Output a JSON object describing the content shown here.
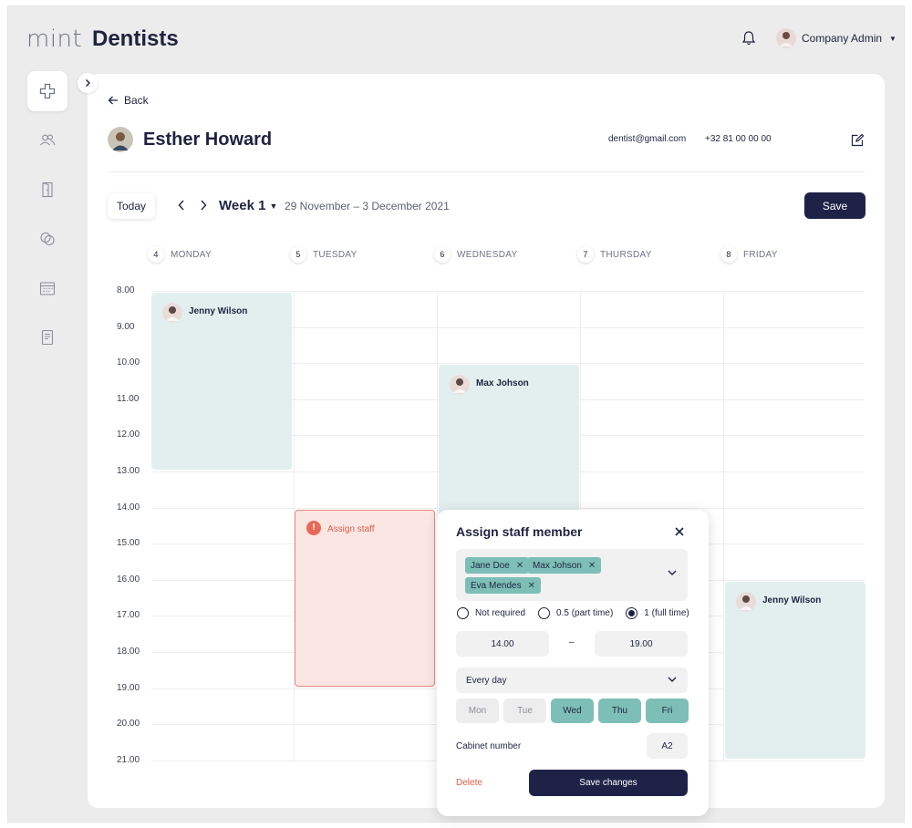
{
  "app": {
    "logo": "mint",
    "title": "Dentists"
  },
  "header": {
    "user_name": "Company Admin"
  },
  "sidebar": {
    "items": [
      {
        "icon": "cross-icon",
        "active": true
      },
      {
        "icon": "users-icon",
        "active": false
      },
      {
        "icon": "door-icon",
        "active": false
      },
      {
        "icon": "circles-icon",
        "active": false
      },
      {
        "icon": "calendar-icon",
        "active": false
      },
      {
        "icon": "document-icon",
        "active": false
      }
    ]
  },
  "profile": {
    "back_label": "Back",
    "name": "Esther Howard",
    "email": "dentist@gmail.com",
    "phone": "+32 81 00 00 00"
  },
  "toolbar": {
    "today_label": "Today",
    "week_label": "Week 1",
    "date_range": "29 November – 3 December 2021",
    "save_label": "Save"
  },
  "calendar": {
    "days": [
      {
        "num": "4",
        "name": "MONDAY"
      },
      {
        "num": "5",
        "name": "TUESDAY"
      },
      {
        "num": "6",
        "name": "WEDNESDAY"
      },
      {
        "num": "7",
        "name": "THURSDAY"
      },
      {
        "num": "8",
        "name": "FRIDAY"
      }
    ],
    "times": [
      "8.00",
      "9.00",
      "10.00",
      "11.00",
      "12.00",
      "13.00",
      "14.00",
      "15.00",
      "16.00",
      "17.00",
      "18.00",
      "19.00",
      "20.00",
      "21.00"
    ],
    "events": [
      {
        "day": "MONDAY",
        "start": "8.00",
        "end": "13.00",
        "label": "Jenny Wilson",
        "kind": "staff"
      },
      {
        "day": "WEDNESDAY",
        "start": "10.00",
        "end": "16.00",
        "label": "Max Johson",
        "kind": "staff"
      },
      {
        "day": "TUESDAY",
        "start": "14.00",
        "end": "19.00",
        "label": "Assign staff",
        "kind": "alert"
      },
      {
        "day": "FRIDAY",
        "start": "16.00",
        "end": "21.00",
        "label": "Jenny Wilson",
        "kind": "staff"
      }
    ]
  },
  "popup": {
    "title": "Assign staff member",
    "tags": [
      "Jane Doe",
      "Max Johson",
      "Eva Mendes"
    ],
    "radios": [
      {
        "label": "Not required",
        "selected": false
      },
      {
        "label": "0.5 (part time)",
        "selected": false
      },
      {
        "label": "1 (full time)",
        "selected": true
      }
    ],
    "time_from": "14.00",
    "time_separator": "–",
    "time_to": "19.00",
    "repeat": "Every day",
    "weekdays": [
      {
        "label": "Mon",
        "selected": false
      },
      {
        "label": "Tue",
        "selected": false
      },
      {
        "label": "Wed",
        "selected": true
      },
      {
        "label": "Thu",
        "selected": true
      },
      {
        "label": "Fri",
        "selected": true
      }
    ],
    "cabinet_label": "Cabinet number",
    "cabinet_value": "A2",
    "delete_label": "Delete",
    "save_label": "Save changes"
  },
  "colors": {
    "primary": "#1e2247",
    "teal": "#7dbfb6",
    "teal_light": "#e2efee",
    "alert": "#e66a56",
    "alert_bg": "#fbe6e3"
  }
}
